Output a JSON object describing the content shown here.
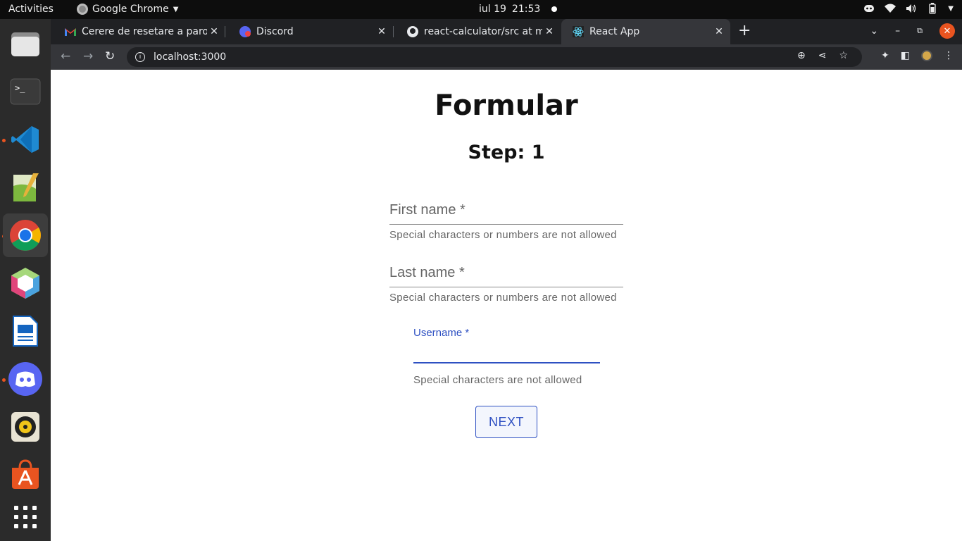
{
  "system": {
    "activities": "Activities",
    "app_name": "Google Chrome",
    "date": "iul 19",
    "time": "21:53"
  },
  "tabs": [
    {
      "title": "Cerere de resetare a parol",
      "favicon": "gmail-icon"
    },
    {
      "title": "Discord",
      "favicon": "discord-icon"
    },
    {
      "title": "react-calculator/src at ma",
      "favicon": "github-icon"
    },
    {
      "title": "React App",
      "favicon": "react-icon",
      "active": true
    }
  ],
  "address_bar": {
    "url": "localhost:3000"
  },
  "dock": [
    "files",
    "terminal",
    "vscode",
    "text-editor",
    "chrome",
    "netbeans",
    "libreoffice-writer",
    "discord",
    "rhythmbox",
    "software-center",
    "show-apps"
  ],
  "form": {
    "title": "Formular",
    "step": "Step: 1",
    "first_name": {
      "label": "First name *",
      "helper": "Special characters or numbers are not allowed"
    },
    "last_name": {
      "label": "Last name *",
      "helper": "Special characters or numbers are not allowed"
    },
    "username": {
      "label": "Username *",
      "helper": "Special characters are not allowed"
    },
    "next_label": "NEXT"
  },
  "colors": {
    "primary": "#2e50c2",
    "chrome_dark": "#202124",
    "ubuntu_orange": "#e95420"
  }
}
